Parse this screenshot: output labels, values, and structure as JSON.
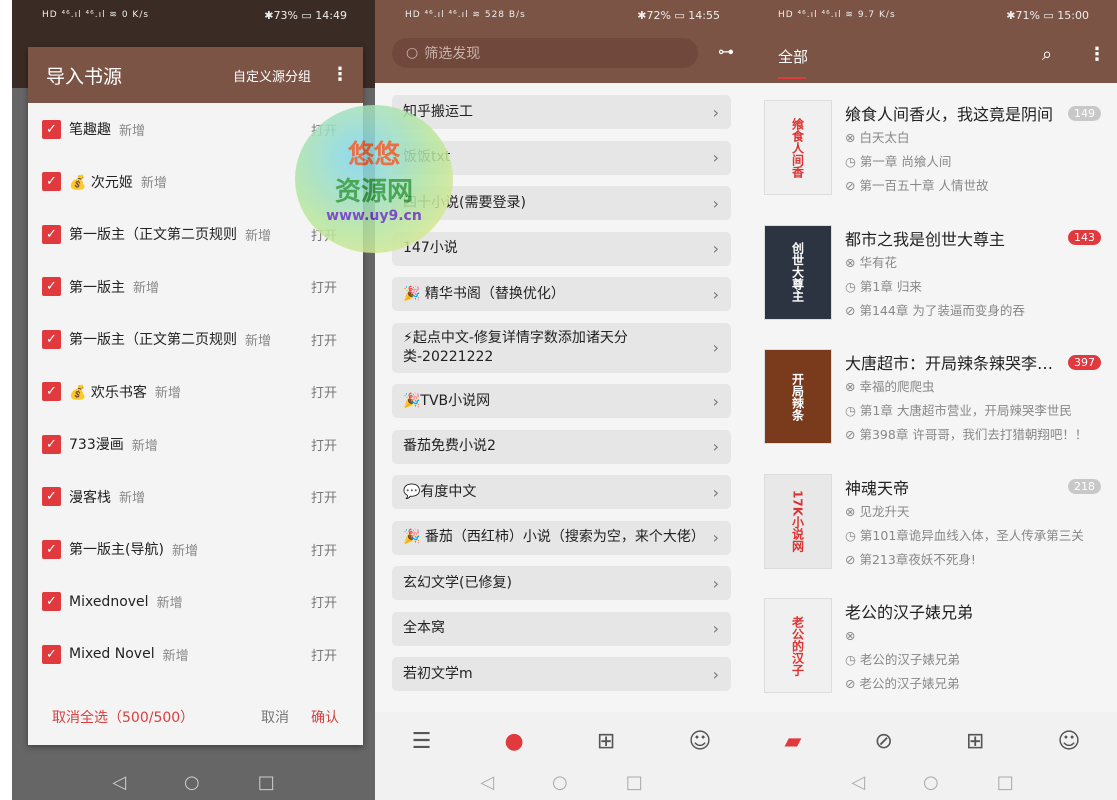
{
  "colors": {
    "brand_brown": "#7b5446",
    "accent_red": "#e0393e"
  },
  "screen1": {
    "status": {
      "left": "HD ⁴⁶.ıl ⁴⁶.ıl ≋ 0 K/s",
      "right": "✱73% ▭ 14:49"
    },
    "dialog": {
      "title": "导入书源",
      "group_button": "自定义源分组",
      "menu_icon": "more-vert-icon",
      "items": [
        {
          "name": "笔趣趣",
          "status": "新增",
          "action": "打开"
        },
        {
          "name": "💰 次元姬",
          "status": "新增",
          "action": ""
        },
        {
          "name": "第一版主（正文第二页规则",
          "status": "新增",
          "action": "打开"
        },
        {
          "name": "第一版主",
          "status": "新增",
          "action": "打开"
        },
        {
          "name": "第一版主（正文第二页规则",
          "status": "新增",
          "action": "打开"
        },
        {
          "name": "💰 欢乐书客",
          "status": "新增",
          "action": "打开"
        },
        {
          "name": "733漫画",
          "status": "新增",
          "action": "打开"
        },
        {
          "name": "漫客栈",
          "status": "新增",
          "action": "打开"
        },
        {
          "name": "第一版主(导航)",
          "status": "新增",
          "action": "打开"
        },
        {
          "name": "Mixednovel",
          "status": "新增",
          "action": "打开"
        },
        {
          "name": "Mixed Novel",
          "status": "新增",
          "action": "打开"
        }
      ],
      "deselect_all": "取消全选（500/500）",
      "cancel": "取消",
      "confirm": "确认"
    }
  },
  "watermark": {
    "line1": "悠悠",
    "line2": "资源网",
    "line3": "www.uy9.cn"
  },
  "screen2": {
    "status": {
      "left": "HD ⁴⁶.ıl ⁴⁶.ıl ≋ 528 B/s",
      "right": "✱72% ▭ 14:55"
    },
    "search_placeholder": "筛选发现",
    "items": [
      "知乎搬运工",
      "饭饭txt",
      "四十小说(需要登录)",
      "147小说",
      "🎉 精华书阁（替换优化）",
      "⚡起点中文-修复详情字数添加诸天分类-20221222",
      "🎉TVB小说网",
      "番茄免费小说2",
      "💬有度中文",
      "🎉 番茄（西红柿）小说（搜索为空，来个大佬）",
      "玄幻文学(已修复)",
      "全本窝",
      "若初文学m"
    ],
    "nav": [
      "bookshelf-icon",
      "explore-icon",
      "bookmark-icon",
      "profile-icon"
    ]
  },
  "screen3": {
    "status": {
      "left": "HD ⁴⁶.ıl ⁴⁶.ıl ≋ 9.7 K/s",
      "right": "✱71% ▭ 15:00"
    },
    "tab": "全部",
    "books": [
      {
        "title": "飨食人间香火，我这竟是阴间",
        "badge": "149",
        "badge_color": "#c8c8c8",
        "author": "白天太白",
        "read": "第一章 尚飨人间",
        "latest": "第一百五十章 人情世故",
        "cover": "飨食人间香",
        "cover_bg": "#f0f0f0"
      },
      {
        "title": "都市之我是创世大尊主",
        "badge": "143",
        "badge_color": "#e0393e",
        "author": "华有花",
        "read": "第1章 归来",
        "latest": "第144章 为了装逼而变身的吞",
        "cover": "创世大尊主",
        "cover_bg": "#2b3440"
      },
      {
        "title": "大唐超市：开局辣条辣哭李世民",
        "badge": "397",
        "badge_color": "#e0393e",
        "author": "幸福的爬爬虫",
        "read": "第1章 大唐超市营业，开局辣哭李世民",
        "latest": "第398章 许哥哥，我们去打猎朝翔吧！！",
        "cover": "开局辣条",
        "cover_bg": "#7a3a1c"
      },
      {
        "title": "神魂天帝",
        "badge": "218",
        "badge_color": "#c8c8c8",
        "author": "见龙升天",
        "read": "第101章诡异血线入体，圣人传承第三关",
        "latest": "第213章夜妖不死身!",
        "cover": "17K小说网",
        "cover_bg": "#e8e8e8"
      },
      {
        "title": "老公的汉子婊兄弟",
        "badge": "",
        "badge_color": "",
        "author": "",
        "read": "老公的汉子婊兄弟",
        "latest": "老公的汉子婊兄弟",
        "cover": "老公的汉子",
        "cover_bg": "#f0f0f0"
      }
    ]
  }
}
